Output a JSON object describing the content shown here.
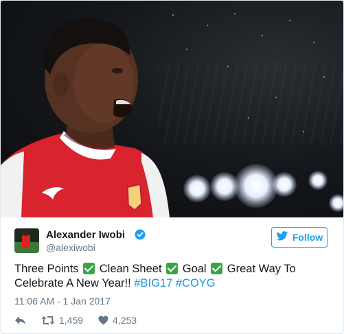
{
  "user": {
    "display_name": "Alexander Iwobi",
    "handle": "@alexiwobi",
    "verified": true,
    "follow_label": "Follow"
  },
  "tweet": {
    "segments": {
      "s1": "Three Points",
      "s2": "Clean Sheet",
      "s3": "Goal",
      "s4": "Great Way To Celebrate A New Year!!",
      "tag1": "#BIG17",
      "tag2": "#COYG"
    },
    "timestamp": "11:06 AM - 1 Jan 2017"
  },
  "actions": {
    "retweet_count": "1,459",
    "like_count": "4,253"
  },
  "colors": {
    "accent": "#1da1f2",
    "hashtag": "#1b95e0",
    "check": "#3aa546",
    "muted": "#657786"
  },
  "icons": [
    "verified-badge-icon",
    "twitter-bird-icon",
    "reply-icon",
    "retweet-icon",
    "heart-icon",
    "check-mark-icon"
  ]
}
